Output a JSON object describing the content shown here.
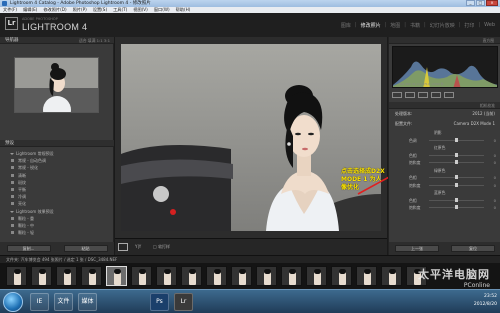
{
  "window": {
    "title": "Lightroom 4 Catalog - Adobe Photoshop Lightroom 4 - 修改照片",
    "buttons": [
      "_",
      "□",
      "×"
    ]
  },
  "menu": [
    "文件(F)",
    "编辑(E)",
    "修改照片(D)",
    "照片(P)",
    "设置(S)",
    "工具(T)",
    "视图(V)",
    "窗口(W)",
    "帮助(H)"
  ],
  "header": {
    "logo": "Lr",
    "subtitle": "ADOBE PHOTOSHOP",
    "app_name": "LIGHTROOM 4",
    "modules": [
      "图库",
      "修改照片",
      "地图",
      "书籍",
      "幻灯片放映",
      "打印",
      "Web"
    ],
    "active_module": "修改照片"
  },
  "left_panel": {
    "navigator_title": "导航器",
    "navigator_modes": "适合  填满  1:1  3:1",
    "presets_title": "预设",
    "presets": [
      {
        "label": "Lightroom 常规预设",
        "type": "folder"
      },
      {
        "label": "常规 - 自动色调",
        "type": "item"
      },
      {
        "label": "常规 - 锐化",
        "type": "item"
      },
      {
        "label": "清晰",
        "type": "item"
      },
      {
        "label": "斑纹",
        "type": "item"
      },
      {
        "label": "平衡",
        "type": "item"
      },
      {
        "label": "冷调",
        "type": "item"
      },
      {
        "label": "亮化",
        "type": "item"
      },
      {
        "label": "Lightroom 效果预设",
        "type": "folder"
      },
      {
        "label": "颗粒 - 重",
        "type": "item"
      },
      {
        "label": "颗粒 - 中",
        "type": "item"
      },
      {
        "label": "颗粒 - 轻",
        "type": "item"
      }
    ],
    "copy_button": "复制...",
    "paste_button": "粘贴"
  },
  "toolbar": {
    "softproof": "软打样"
  },
  "annotation": "点击选择成D2X MODE 1 为人像优化",
  "right_panel": {
    "histogram_title": "直方图",
    "camera_info": "ISO 200   31 mm   f/5.6   1/500 秒",
    "section_title": "相机校准",
    "process_label": "处理版本:",
    "process_value": "2012 (当前)",
    "profile_label": "配置文件:",
    "profile_value": "Camera D2X Mode 1",
    "groups": [
      {
        "title": "阴影",
        "sliders": [
          {
            "label": "色调",
            "value": 0
          }
        ]
      },
      {
        "title": "红原色",
        "sliders": [
          {
            "label": "色相",
            "value": 0
          },
          {
            "label": "饱和度",
            "value": 0
          }
        ]
      },
      {
        "title": "绿原色",
        "sliders": [
          {
            "label": "色相",
            "value": 0
          },
          {
            "label": "饱和度",
            "value": 0
          }
        ]
      },
      {
        "title": "蓝原色",
        "sliders": [
          {
            "label": "色相",
            "value": 0
          },
          {
            "label": "饱和度",
            "value": 0
          }
        ]
      }
    ],
    "prev_button": "上一张",
    "reset_button": "复位"
  },
  "filmstrip": {
    "info": "文件夹: 汽车博览会   494 张照片 / 选定 1 张 / DSC_3484.NEF",
    "thumb_count": 17,
    "selected_index": 4
  },
  "watermark": {
    "text": "太平洋电脑网",
    "url": "PConline"
  },
  "taskbar": {
    "icons": [
      "IE",
      "文件",
      "媒体",
      "Ps",
      "Lr"
    ],
    "time": "23:52",
    "date": "2012/8/20"
  }
}
